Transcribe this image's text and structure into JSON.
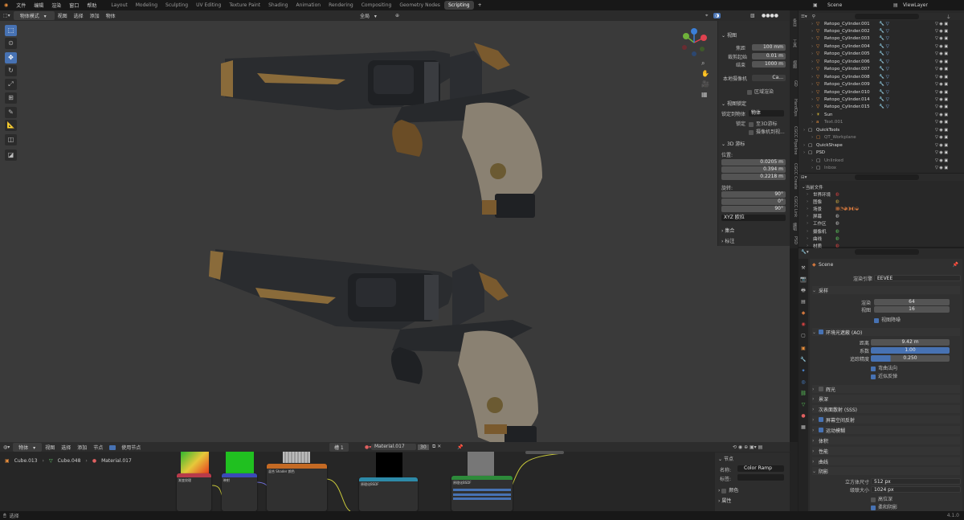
{
  "topbar": {
    "menu": [
      "文件",
      "编辑",
      "渲染",
      "窗口",
      "帮助"
    ],
    "workspaces": [
      "Layout",
      "Modeling",
      "Sculpting",
      "UV Editing",
      "Texture Paint",
      "Shading",
      "Animation",
      "Rendering",
      "Compositing",
      "Geometry Nodes",
      "Scripting"
    ],
    "active_workspace": "Scripting",
    "scene": "Scene",
    "view_layer": "ViewLayer"
  },
  "viewport": {
    "mode": "物体模式",
    "menus": [
      "视图",
      "选择",
      "添加",
      "物体"
    ],
    "transform_orientation": "全局",
    "npanel": {
      "view_header": "视图",
      "focal_label": "焦距",
      "focal_value": "100 mm",
      "clip_start_label": "裁剪起始",
      "clip_start_value": "0.01 m",
      "clip_end_label": "结束",
      "clip_end_value": "1000 m",
      "local_camera_label": "本地摄像机",
      "local_camera_value": "Ca...",
      "region_label": "区域渲染",
      "view_lock_header": "视图锁定",
      "lock_object_label": "锁定到物体",
      "lock_object_value": "物体",
      "lock_label": "锁定",
      "lock_3d_cursor": "至3D游标",
      "lock_camera_view": "摄像机到视...",
      "cursor_header": "3D 游标",
      "location_label": "位置:",
      "loc_x": "0.0205 m",
      "loc_y": "0.394 m",
      "loc_z": "0.2218 m",
      "rotation_label": "旋转:",
      "rot_x": "90°",
      "rot_y": "0°",
      "rot_z": "90°",
      "rot_mode": "XYZ 欧拉",
      "collections_header": "集合",
      "annotations_header": "标注"
    },
    "vtabs": [
      "条目",
      "工具",
      "视图",
      "GD",
      "HardOps",
      "CGCC Pipeline",
      "CGCC Create",
      "CGCC Link",
      "编辑",
      "PSD"
    ]
  },
  "outliner": {
    "search_placeholder": "",
    "items": [
      {
        "name": "Retopo_Cylinder.001"
      },
      {
        "name": "Retopo_Cylinder.002"
      },
      {
        "name": "Retopo_Cylinder.003"
      },
      {
        "name": "Retopo_Cylinder.004"
      },
      {
        "name": "Retopo_Cylinder.005"
      },
      {
        "name": "Retopo_Cylinder.006"
      },
      {
        "name": "Retopo_Cylinder.007"
      },
      {
        "name": "Retopo_Cylinder.008"
      },
      {
        "name": "Retopo_Cylinder.009"
      },
      {
        "name": "Retopo_Cylinder.010"
      },
      {
        "name": "Retopo_Cylinder.014"
      },
      {
        "name": "Retopo_Cylinder.015"
      },
      {
        "name": "Sun"
      },
      {
        "name": "Text.001"
      },
      {
        "name": "QuickTools"
      },
      {
        "name": "QT_Workplane"
      },
      {
        "name": "QuickShape"
      },
      {
        "name": "PSD"
      },
      {
        "name": "Unlinked"
      },
      {
        "name": "Inbox"
      }
    ]
  },
  "filebrowser": {
    "root": "当前文件",
    "items": [
      "世界环境",
      "图像",
      "场景",
      "屏幕",
      "工作区",
      "摄像机",
      "曲线",
      "材质"
    ]
  },
  "properties": {
    "scene_name": "Scene",
    "render_engine_label": "渲染引擎",
    "render_engine": "EEVEE",
    "sampling_header": "采样",
    "render_label": "渲染",
    "render_value": "64",
    "viewport_label": "视图",
    "viewport_value": "16",
    "viewport_denoise": "视图降噪",
    "ao_header": "环境光遮蔽 (AO)",
    "distance_label": "距离",
    "distance_value": "9.42 m",
    "factor_label": "系数",
    "factor_value": "1.00",
    "trace_label": "追踪精度",
    "trace_value": "0.250",
    "bent_normals": "弯曲法向",
    "bounces": "近似反弹",
    "bloom": "辉光",
    "dof": "景深",
    "sss": "次表面散射 (SSS)",
    "ssr": "屏幕空间反射",
    "motion_blur": "运动模糊",
    "volumetrics": "体积",
    "performance": "性能",
    "curves": "曲线",
    "shadows": "阴影",
    "cube_size_label": "立方体尺寸",
    "cube_size_value": "512 px",
    "cascade_label": "级联大小",
    "cascade_value": "1024 px",
    "high_bitdepth": "高位深",
    "soft_shadows": "柔和阴影",
    "version": "4.1.0"
  },
  "node_editor": {
    "editor": "物体",
    "menus": [
      "视图",
      "选择",
      "添加",
      "节点"
    ],
    "use_nodes": "使用节点",
    "slot": "槽 1",
    "material": "Material.017",
    "users": "30",
    "breadcrumb": [
      "Cube.013",
      "Cube.048",
      "Material.017"
    ],
    "node_panel": {
      "header": "节点",
      "name_label": "名称:",
      "name_value": "Color Ramp",
      "label_label": "标签:",
      "color_header": "颜色",
      "props_header": "属性"
    },
    "node_titles": [
      "渐变纹理",
      "映射",
      "混合 Shader 颜色",
      "原理化BSDF",
      "原理化BSDF"
    ]
  },
  "statusbar": {
    "action": "选择",
    "version": "4.1.0"
  }
}
